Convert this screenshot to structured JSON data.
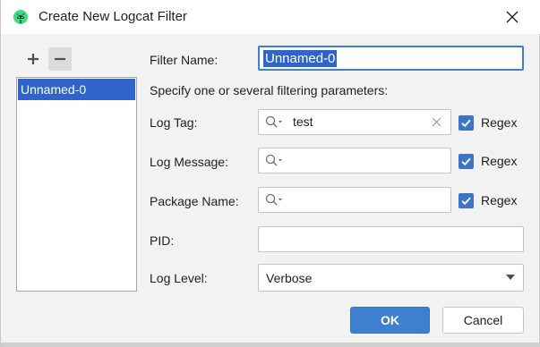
{
  "window": {
    "title": "Create New Logcat Filter",
    "icon": "android-icon"
  },
  "toolbar": {
    "add_label": "+",
    "remove_label": "−"
  },
  "filter_list": {
    "items": [
      "Unnamed-0"
    ],
    "selected": "Unnamed-0"
  },
  "form": {
    "filter_name_label": "Filter Name:",
    "filter_name_value": "Unnamed-0",
    "instructions": "Specify one or several filtering parameters:",
    "log_tag_label": "Log Tag:",
    "log_tag_value": "test",
    "log_message_label": "Log Message:",
    "log_message_value": "",
    "package_name_label": "Package Name:",
    "package_name_value": "",
    "regex_label": "Regex",
    "regex_checked": [
      true,
      true,
      true
    ],
    "pid_label": "PID:",
    "pid_value": "",
    "log_level_label": "Log Level:",
    "log_level_value": "Verbose"
  },
  "buttons": {
    "ok": "OK",
    "cancel": "Cancel"
  },
  "colors": {
    "accent": "#3e7fd0",
    "selection": "#2f65ca",
    "focus_border": "#3c7fd8",
    "android_green": "#3ddc84"
  }
}
